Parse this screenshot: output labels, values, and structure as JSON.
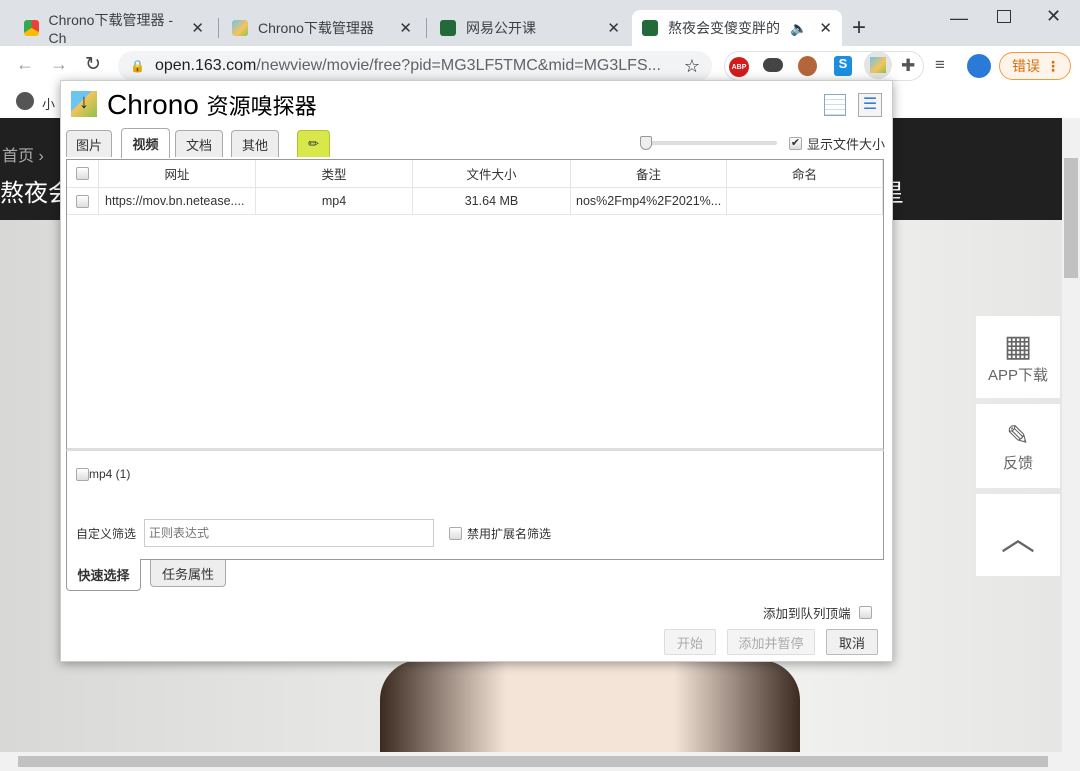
{
  "browser": {
    "tabs": [
      {
        "title": "Chrono下载管理器 - Ch",
        "active": false
      },
      {
        "title": "Chrono下载管理器",
        "active": false
      },
      {
        "title": "网易公开课",
        "active": false
      },
      {
        "title": "熬夜会变傻变胖的科",
        "active": true
      }
    ],
    "url_host": "open.163.com",
    "url_path": "/newview/movie/free?pid=MG3LF5TMC&mid=MG3LFS...",
    "error_label": "错误",
    "bookmark_label": "小"
  },
  "page": {
    "breadcrumb": "首页",
    "title_fragment": "熬夜会",
    "title_end": "星",
    "side": {
      "app": "APP下载",
      "feedback": "反馈"
    }
  },
  "popup": {
    "brand": "Chrono",
    "title": "资源嗅探器",
    "tabs": [
      "图片",
      "视频",
      "文档",
      "其他"
    ],
    "active_tab": "视频",
    "show_size_label": "显示文件大小",
    "show_size_checked": true,
    "slider_value": 0,
    "columns": [
      "网址",
      "类型",
      "文件大小",
      "备注",
      "命名"
    ],
    "rows": [
      {
        "url": "https://mov.bn.netease....",
        "type": "mp4",
        "size": "31.64 MB",
        "note": "nos%2Fmp4%2F2021%...",
        "name": ""
      }
    ],
    "filter_ext": "mp4 (1)",
    "custom_filter_label": "自定义筛选",
    "custom_filter_placeholder": "正则表达式",
    "disable_ext_label": "禁用扩展名筛选",
    "bottom_tabs": [
      "快速选择",
      "任务属性"
    ],
    "queue_top_label": "添加到队列顶端",
    "buttons": {
      "start": "开始",
      "add_pause": "添加并暂停",
      "cancel": "取消"
    }
  }
}
